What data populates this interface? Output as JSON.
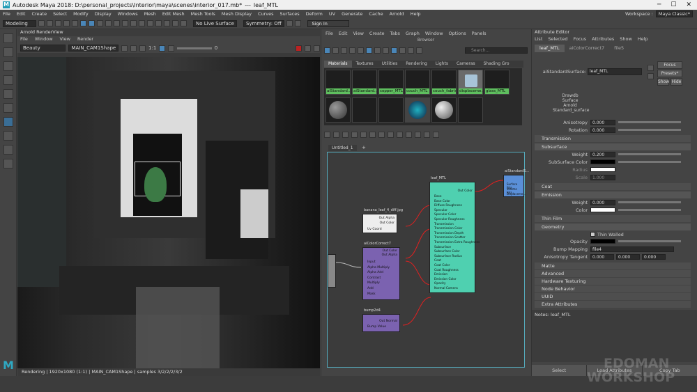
{
  "window": {
    "title": "Autodesk Maya 2018: D:\\personal_projects\\Interior\\maya\\scenes\\interior_017.mb*",
    "separator": "---",
    "object": "leaf_MTL"
  },
  "menubar": {
    "items": [
      "File",
      "Edit",
      "Create",
      "Select",
      "Modify",
      "Display",
      "Windows",
      "Mesh",
      "Edit Mesh",
      "Mesh Tools",
      "Mesh Display",
      "Curves",
      "Surfaces",
      "Deform",
      "UV",
      "Generate",
      "Cache",
      "Arnold",
      "Help"
    ],
    "workspace_label": "Workspace :",
    "workspace_value": "Maya Classic*"
  },
  "shelf": {
    "mode": "Modeling",
    "live": "No Live Surface",
    "symmetry": "Symmetry: Off",
    "signin": "Sign In"
  },
  "render_view": {
    "title": "Arnold RenderView",
    "menu": [
      "File",
      "Window",
      "View",
      "Render"
    ],
    "aov": "Beauty",
    "camera": "MAIN_CAM1Shape",
    "ratio": "1:1",
    "exposure": "0",
    "status": "Rendering | 1920x1080 (1:1) | MAIN_CAM1Shape | samples 3/2/2/2/3/2"
  },
  "hypershade": {
    "menu": [
      "File",
      "Edit",
      "View",
      "Create",
      "Tabs",
      "Graph",
      "Window",
      "Options",
      "Panels"
    ],
    "browser_label": "Browser",
    "search_placeholder": "Search...",
    "tabs": [
      "Materials",
      "Textures",
      "Utilities",
      "Rendering",
      "Lights",
      "Cameras",
      "Shading Gro"
    ],
    "materials": [
      "aiStandard...",
      "aiStandard...",
      "copper_MTL",
      "couch_MTL",
      "couch_fabric...",
      "displaceme...",
      "glass_MTL"
    ],
    "graph_tab": "Untitled_1",
    "graph_add": "+",
    "nodes": {
      "leaf": "leaf_MTL",
      "leaf_out": "Out Color",
      "leaf_attrs": [
        "Base",
        "Base Color",
        "Diffuse Roughness",
        "Specular",
        "Specular Color",
        "Specular Roughness",
        "Transmission",
        "Transmission Color",
        "Transmission Depth",
        "Transmission Scatter",
        "Transmission Extra Roughness",
        "Subsurface",
        "Subsurface Color",
        "Subsurface Radius",
        "Coat",
        "Coat Color",
        "Coat Roughness",
        "Emission",
        "Emission Color",
        "Opacity",
        "Normal Camera"
      ],
      "file": "banana_leaf_4_diff.jpg",
      "file_out": [
        "Out Alpha",
        "Out Color",
        "Uv Coord"
      ],
      "cc": "aiColorCorrect7",
      "cc_out": [
        "Out Color",
        "Out Alpha"
      ],
      "cc_in": [
        "Input",
        "Alpha Multiply",
        "Alpha Add",
        "Contrast",
        "Multiply",
        "Add",
        "Mask"
      ],
      "bump": "bump2d4",
      "bump_out": "Out Normal",
      "bump_in": "Bump Value",
      "sg": "aiStandardS...",
      "sg_in": [
        "Surface Sha...",
        "Volume Sha...",
        "Displaceme..."
      ]
    }
  },
  "attr_editor": {
    "title": "Attribute Editor",
    "menu": [
      "List",
      "Selected",
      "Focus",
      "Attributes",
      "Show",
      "Help"
    ],
    "tabs": [
      "leaf_MTL",
      "aiColorCorrect7",
      "file5"
    ],
    "shader_label": "aiStandardSurface:",
    "shader_value": "leaf_MTL",
    "focus": "Focus",
    "presets": "Presets*",
    "show": "Show",
    "hide": "Hide",
    "swatch_text": [
      "Drawdb",
      "Surface",
      "Arnold",
      "Standard_surface"
    ],
    "anisotropy_label": "Anisotropy",
    "anisotropy": "0.000",
    "rotation_label": "Rotation",
    "rotation": "0.000",
    "sections": [
      "Transmission",
      "Subsurface",
      "Coat",
      "Emission",
      "Thin Film",
      "Geometry",
      "Matte",
      "Advanced",
      "Hardware Texturing",
      "Node Behavior",
      "UUID",
      "Extra Attributes"
    ],
    "sss_weight_label": "Weight",
    "sss_weight": "0.200",
    "sss_color_label": "SubSurface Color",
    "radius_label": "Radius",
    "scale_label": "Scale",
    "scale": "1.000",
    "em_weight_label": "Weight",
    "em_weight": "0.000",
    "em_color_label": "Color",
    "thin_walled": "Thin Walled",
    "opacity_label": "Opacity",
    "bump_label": "Bump Mapping",
    "bump_value": "file4",
    "aniso_tan_label": "Anisotropy Tangent",
    "aniso_tan": [
      "0.000",
      "0.000",
      "0.000"
    ],
    "notes": "Notes: leaf_MTL",
    "buttons": [
      "Select",
      "Load Attributes",
      "Copy Tab"
    ]
  },
  "watermark": [
    "EDOMAN",
    "WORKSHOP"
  ],
  "colors": {
    "accent": "#1e9bb5",
    "node_green": "#4fd0b0",
    "node_purple": "#7b62b0",
    "wire": "#e02020"
  }
}
